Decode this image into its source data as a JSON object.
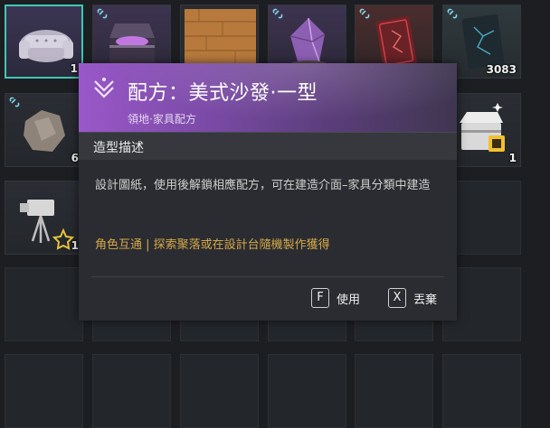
{
  "inventory": {
    "slots": [
      {
        "name": "sofa-item-slot",
        "quantity": "1",
        "linked": true,
        "selected": true
      },
      {
        "name": "chest-item-slot",
        "quantity": "",
        "linked": true
      },
      {
        "name": "wood-floor-item-slot",
        "quantity": "",
        "linked": false
      },
      {
        "name": "crystal-item-slot",
        "quantity": "",
        "linked": true
      },
      {
        "name": "red-card-item-slot",
        "quantity": "",
        "linked": true
      },
      {
        "name": "blue-card-item-slot",
        "quantity": "3083",
        "linked": true
      },
      {
        "name": "stone-item-slot",
        "quantity": "6",
        "linked": true
      },
      {
        "name": "reward-chest-item-slot",
        "quantity": "1",
        "linked": false
      },
      {
        "name": "camera-item-slot",
        "quantity": "1",
        "linked": false
      }
    ]
  },
  "tooltip": {
    "title": "配方：美式沙發·一型",
    "subtitle": "領地·家具配方",
    "section_title": "造型描述",
    "description": "設計圖紙，使用後解鎖相應配方，可在建造介面–家具分類中建造",
    "source": "角色互通 | 探索聚落或在設計台隨機製作獲得",
    "actions": [
      {
        "key": "F",
        "label": "使用"
      },
      {
        "key": "X",
        "label": "丟棄"
      }
    ]
  },
  "colors": {
    "rarity_purple": "#9a58c8",
    "selected_border": "#3fc7b4",
    "source_text": "#d4a84a"
  }
}
